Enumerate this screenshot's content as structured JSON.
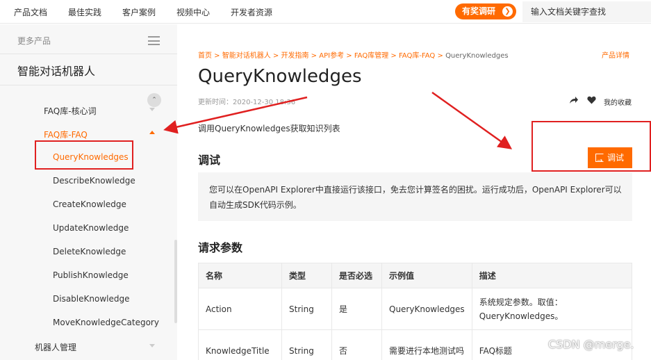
{
  "topnav": {
    "items": [
      "产品文档",
      "最佳实践",
      "客户案例",
      "视频中心",
      "开发者资源"
    ],
    "survey_label": "有奖调研",
    "search_placeholder": "输入文档关键字查找"
  },
  "sidebar": {
    "more_products": "更多产品",
    "product_title": "智能对话机器人",
    "items": [
      {
        "label": "FAQ库-核心词",
        "state": "collapsed"
      },
      {
        "label": "FAQ库-FAQ",
        "state": "expanded"
      },
      {
        "label": "QueryKnowledges",
        "state": "selected"
      },
      {
        "label": "DescribeKnowledge"
      },
      {
        "label": "CreateKnowledge"
      },
      {
        "label": "UpdateKnowledge"
      },
      {
        "label": "DeleteKnowledge"
      },
      {
        "label": "PublishKnowledge"
      },
      {
        "label": "DisableKnowledge"
      },
      {
        "label": "MoveKnowledgeCategory"
      },
      {
        "label": "机器人管理",
        "state": "collapsed"
      }
    ]
  },
  "main": {
    "breadcrumb": [
      "首页",
      "智能对话机器人",
      "开发指南",
      "API参考",
      "FAQ库管理",
      "FAQ库-FAQ",
      "QueryKnowledges"
    ],
    "product_detail": "产品详情",
    "title": "QueryKnowledges",
    "update_time": "更新时间：2020-12-30 18:36",
    "favorite_label": "我的收藏",
    "intro": "调用QueryKnowledges获取知识列表",
    "debug_section_title": "调试",
    "debug_button": "调试",
    "debug_note": "您可以在OpenAPI Explorer中直接运行该接口，免去您计算签名的困扰。运行成功后，OpenAPI Explorer可以自动生成SDK代码示例。",
    "params_section_title": "请求参数",
    "table": {
      "headers": [
        "名称",
        "类型",
        "是否必选",
        "示例值",
        "描述"
      ],
      "rows": [
        [
          "Action",
          "String",
          "是",
          "QueryKnowledges",
          "系统规定参数。取值：QueryKnowledges。"
        ],
        [
          "KnowledgeTitle",
          "String",
          "否",
          "需要进行本地测试吗",
          "FAQ标题"
        ]
      ]
    }
  },
  "watermark": "CSDN @merge.",
  "colors": {
    "accent": "#ff6a00",
    "annotation": "#e02020"
  }
}
